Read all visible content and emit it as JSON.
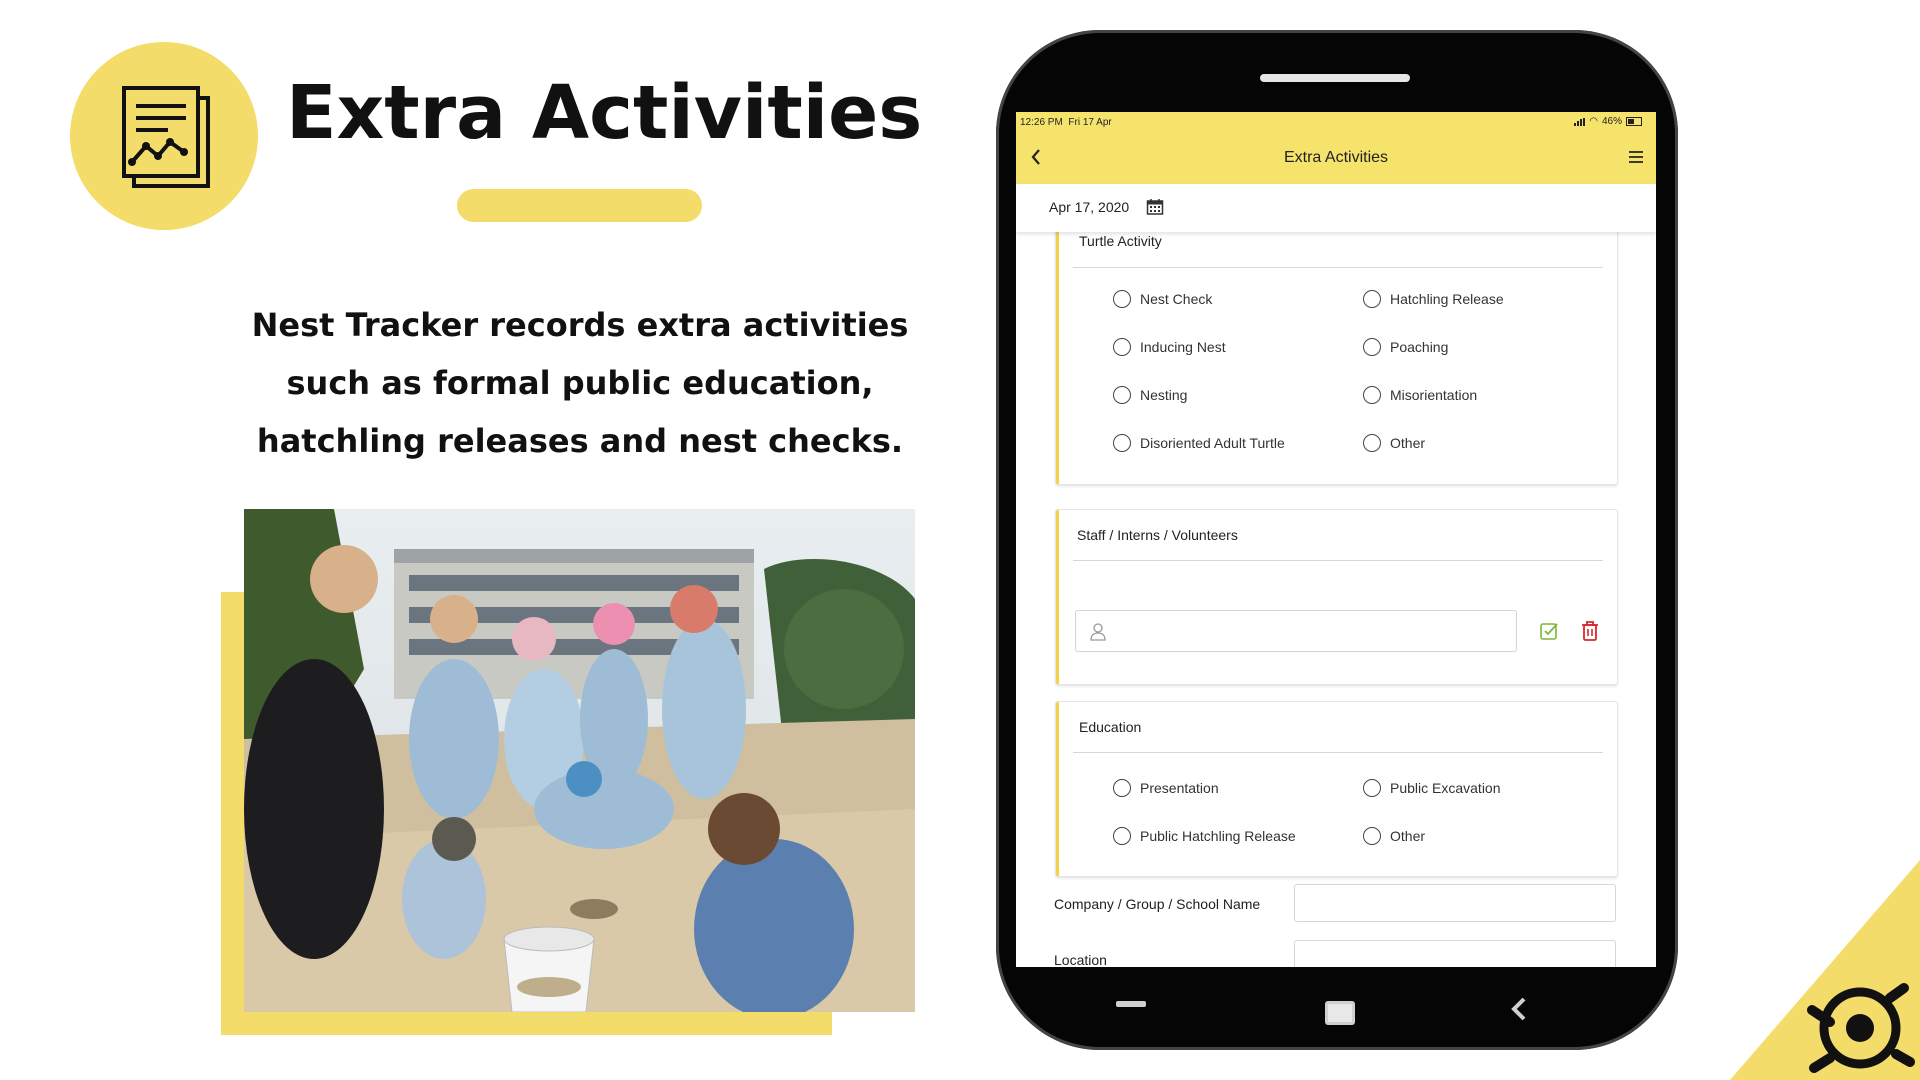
{
  "slide": {
    "title": "Extra Activities",
    "description": "Nest Tracker records extra activities such as formal public education, hatchling releases and nest checks.",
    "logo_icon": "report-chart-icon",
    "corner_logo_icon": "turtle-logo-icon",
    "photo": "people-around-sand-pit-photo"
  },
  "colors": {
    "accent": "#f4dc6b",
    "app_header": "#f6e36c",
    "card_accent": "#f1d24a",
    "delete": "#d9262e",
    "confirm": "#7cb83a"
  },
  "phone": {
    "status_bar": {
      "time": "12:26 PM",
      "date": "Fri 17 Apr",
      "battery": "46%"
    },
    "header": {
      "title": "Extra Activities",
      "back_icon": "chevron-left-icon",
      "menu_icon": "hamburger-menu-icon"
    },
    "date": "Apr 17, 2020",
    "turtle_activity": {
      "title": "Turtle Activity",
      "options": [
        "Nest Check",
        "Hatchling Release",
        "Inducing Nest",
        "Poaching",
        "Nesting",
        "Misorientation",
        "Disoriented Adult Turtle",
        "Other"
      ]
    },
    "staff": {
      "title": "Staff / Interns / Volunteers",
      "input_icon": "person-icon",
      "confirm_icon": "check-square-icon",
      "delete_icon": "trash-icon"
    },
    "education": {
      "title": "Education",
      "options": [
        "Presentation",
        "Public Excavation",
        "Public Hatchling Release",
        "Other"
      ]
    },
    "company_label": "Company / Group / School Name",
    "location_label": "Location"
  }
}
